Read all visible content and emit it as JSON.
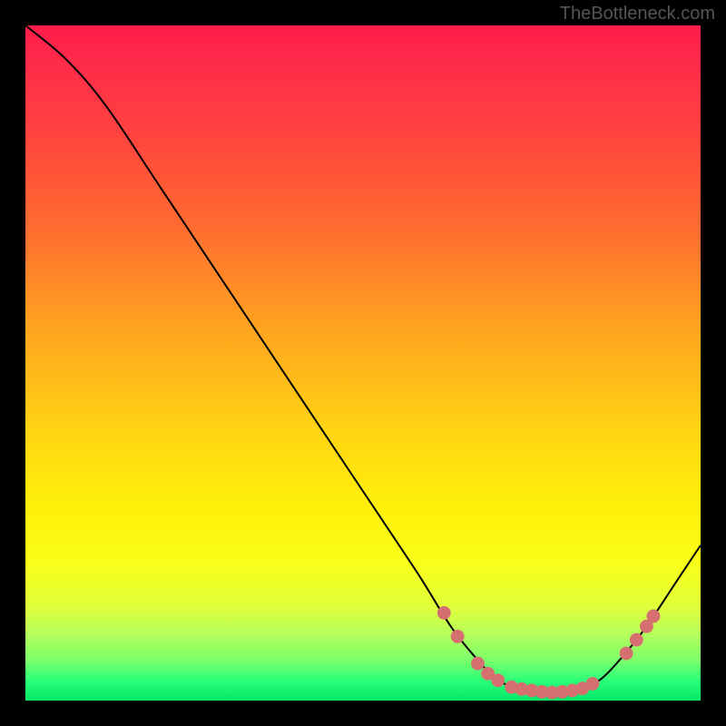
{
  "attribution": "TheBottleneck.com",
  "chart_data": {
    "type": "line",
    "title": "",
    "xlabel": "",
    "ylabel": "",
    "xlim": [
      0,
      100
    ],
    "ylim": [
      0,
      100
    ],
    "curve": [
      {
        "x": 0,
        "y": 100
      },
      {
        "x": 6,
        "y": 95
      },
      {
        "x": 12,
        "y": 88
      },
      {
        "x": 20,
        "y": 76
      },
      {
        "x": 30,
        "y": 61
      },
      {
        "x": 40,
        "y": 46
      },
      {
        "x": 50,
        "y": 31
      },
      {
        "x": 58,
        "y": 19
      },
      {
        "x": 63,
        "y": 11
      },
      {
        "x": 67,
        "y": 6
      },
      {
        "x": 70,
        "y": 3
      },
      {
        "x": 74,
        "y": 1.5
      },
      {
        "x": 78,
        "y": 1.2
      },
      {
        "x": 82,
        "y": 1.5
      },
      {
        "x": 85,
        "y": 3
      },
      {
        "x": 88,
        "y": 6
      },
      {
        "x": 92,
        "y": 11
      },
      {
        "x": 96,
        "y": 17
      },
      {
        "x": 100,
        "y": 23
      }
    ],
    "points": [
      {
        "x": 62,
        "y": 13
      },
      {
        "x": 64,
        "y": 9.5
      },
      {
        "x": 67,
        "y": 5.5
      },
      {
        "x": 68.5,
        "y": 4
      },
      {
        "x": 70,
        "y": 3
      },
      {
        "x": 72,
        "y": 2
      },
      {
        "x": 73.5,
        "y": 1.7
      },
      {
        "x": 75,
        "y": 1.5
      },
      {
        "x": 76.5,
        "y": 1.3
      },
      {
        "x": 78,
        "y": 1.2
      },
      {
        "x": 79.5,
        "y": 1.3
      },
      {
        "x": 81,
        "y": 1.5
      },
      {
        "x": 82.5,
        "y": 1.8
      },
      {
        "x": 84,
        "y": 2.5
      },
      {
        "x": 89,
        "y": 7
      },
      {
        "x": 90.5,
        "y": 9
      },
      {
        "x": 92,
        "y": 11
      },
      {
        "x": 93,
        "y": 12.5
      }
    ],
    "gradient": {
      "top": "#ff1c4a",
      "mid": "#fff20a",
      "bottom": "#04e868"
    },
    "point_color": "#d67070",
    "curve_color": "#000000"
  }
}
